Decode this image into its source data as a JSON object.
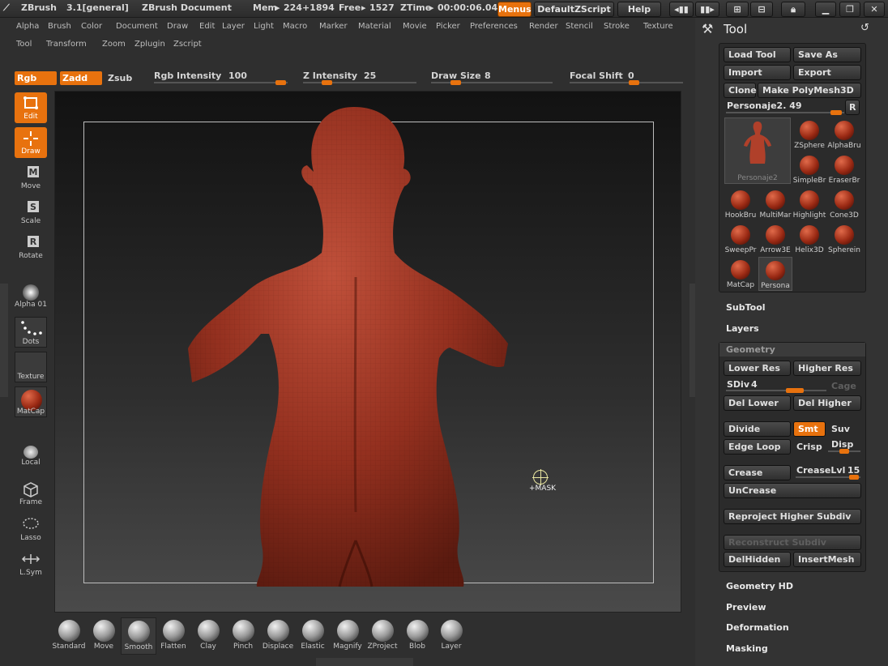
{
  "titlebar": {
    "app": "ZBrush",
    "version": "3.1[general]",
    "document": "ZBrush Document",
    "mem_label": "Mem",
    "mem_value": "224+1894",
    "free_label": "Free",
    "free_value": "1527",
    "ztime_label": "ZTime",
    "ztime_value": "00:00:06.04",
    "menus_btn": "Menus",
    "script_btn": "DefaultZScript",
    "help_btn": "Help"
  },
  "menus": {
    "row1": [
      "Alpha",
      "Brush",
      "Color",
      "Document",
      "Draw",
      "Edit",
      "Layer",
      "Light",
      "Macro",
      "Marker",
      "Material",
      "Movie",
      "Picker",
      "Preferences",
      "Render",
      "Stencil",
      "Stroke",
      "Texture"
    ],
    "row2": [
      "Tool",
      "Transform",
      "Zoom",
      "Zplugin",
      "Zscript"
    ]
  },
  "drawbar": {
    "rgb": "Rgb",
    "zadd": "Zadd",
    "zsub": "Zsub",
    "rgb_intensity_label": "Rgb  Intensity",
    "rgb_intensity": 100,
    "z_intensity_label": "Z  Intensity",
    "z_intensity": 25,
    "draw_size_label": "Draw  Size",
    "draw_size": 8,
    "focal_shift_label": "Focal  Shift",
    "focal_shift": 0
  },
  "left_tools": {
    "edit": "Edit",
    "draw": "Draw",
    "move": "Move",
    "scale": "Scale",
    "rotate": "Rotate",
    "alpha": "Alpha  01",
    "dots": "Dots",
    "texture": "Texture",
    "matcap": "MatCap",
    "local": "Local",
    "frame": "Frame",
    "lasso": "Lasso",
    "lsym": "L.Sym"
  },
  "canvas": {
    "cursor_label": "+MASK"
  },
  "brushes": [
    "Standard",
    "Move",
    "Smooth",
    "Flatten",
    "Clay",
    "Pinch",
    "Displace",
    "Elastic",
    "Magnify",
    "ZProject",
    "Blob",
    "Layer"
  ],
  "tool_panel": {
    "title": "Tool",
    "load_tool": "Load  Tool",
    "save_as": "Save  As",
    "import": "Import",
    "export": "Export",
    "clone": "Clone",
    "make_polymesh": "Make  PolyMesh3D",
    "current_tool": "Personaje2. 49",
    "r_btn": "R",
    "main_thumb_label": "Personaje2",
    "tools": [
      "ZSphere",
      "AlphaBru",
      "SimpleBr",
      "EraserBr",
      "HookBru",
      "MultiMar",
      "Highlight",
      "Cone3D",
      "SweepPr",
      "Arrow3E",
      "Helix3D",
      "Spherein",
      "MatCap",
      "Persona"
    ]
  },
  "sections": {
    "subtool": "SubTool",
    "layers": "Layers",
    "geometry": "Geometry",
    "geometry_hd": "Geometry HD",
    "preview": "Preview",
    "deformation": "Deformation",
    "masking": "Masking"
  },
  "geometry": {
    "lower_res": "Lower  Res",
    "higher_res": "Higher  Res",
    "sdiv_label": "SDiv",
    "sdiv": 4,
    "cage": "Cage",
    "del_lower": "Del  Lower",
    "del_higher": "Del  Higher",
    "divide": "Divide",
    "smt": "Smt",
    "suv": "Suv",
    "edge_loop": "Edge  Loop",
    "crisp": "Crisp",
    "disp": "Disp",
    "crease": "Crease",
    "crease_lvl_label": "CreaseLvl",
    "crease_lvl": 15,
    "uncrease": "UnCrease",
    "reproject": "Reproject  Higher  Subdiv",
    "reconstruct": "Reconstruct  Subdiv",
    "delhidden": "DelHidden",
    "insertmesh": "InsertMesh"
  },
  "colors": {
    "accent": "#e8720e",
    "panel": "#333333",
    "background": "#2f2f2f",
    "model": "#8f2c1c"
  }
}
